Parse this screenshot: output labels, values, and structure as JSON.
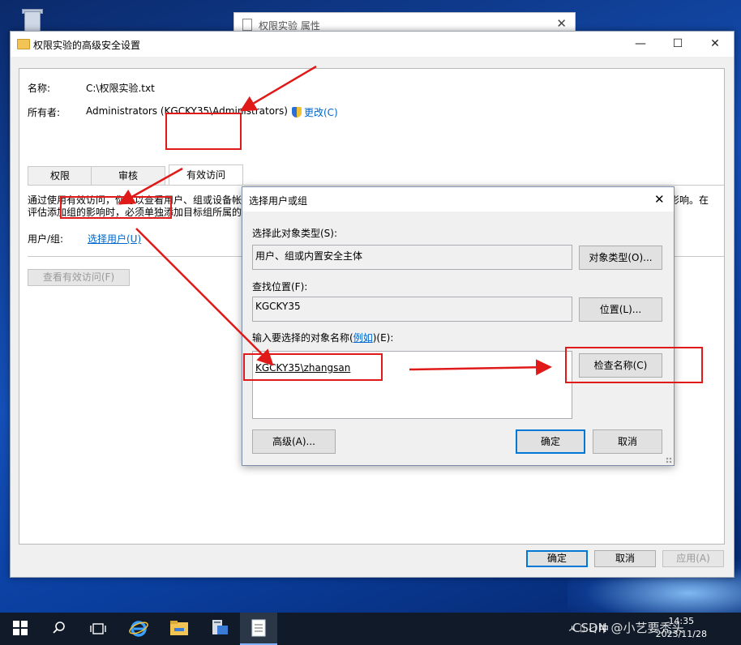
{
  "background_window": {
    "title": "权限实验 属性",
    "close": "✕"
  },
  "window": {
    "title": "权限实验的高级安全设置",
    "controls": {
      "minimize": "—",
      "maximize": "☐",
      "close": "✕"
    },
    "name_label": "名称:",
    "name_value": "C:\\权限实验.txt",
    "owner_label": "所有者:",
    "owner_value": "Administrators (KGCKY35\\Administrators)",
    "change_link": "更改(C)",
    "tabs": [
      {
        "label": "权限"
      },
      {
        "label": "审核"
      },
      {
        "label": "有效访问"
      }
    ],
    "description": "通过使用有效访问，你可以查看用户、组或设备帐户的有效权限。如果帐户是域成员，则还可以评估可能会向帐户的安全令牌中执行添加操作所产生的影响。在评估添加组的影响时，必须单独添加目标组所属的任何组。",
    "user_group_label": "用户/组:",
    "select_user_link": "选择用户(U)",
    "view_access_button": "查看有效访问(F)",
    "ok_button": "确定",
    "cancel_button": "取消",
    "apply_button": "应用(A)"
  },
  "dialog": {
    "title": "选择用户或组",
    "close": "✕",
    "object_type_label": "选择此对象类型(S):",
    "object_type_value": "用户、组或内置安全主体",
    "object_type_button": "对象类型(O)...",
    "location_label": "查找位置(F):",
    "location_value": "KGCKY35",
    "location_button": "位置(L)...",
    "names_label_prefix": "输入要选择的对象名称(",
    "names_label_link": "例如",
    "names_label_suffix": ")(E):",
    "names_value": "KGCKY35\\zhangsan",
    "check_names_button": "检查名称(C)",
    "advanced_button": "高级(A)...",
    "ok_button": "确定",
    "cancel_button": "取消"
  },
  "taskbar": {
    "tray_text": "ㅅ ⌷ ◁ 中",
    "time": "14:35",
    "date": "2023/11/28",
    "watermark": "CSDN @小艺要秃头"
  },
  "colors": {
    "annotation_red": "#e01919",
    "accent": "#0078d7",
    "link": "#0066cc"
  }
}
